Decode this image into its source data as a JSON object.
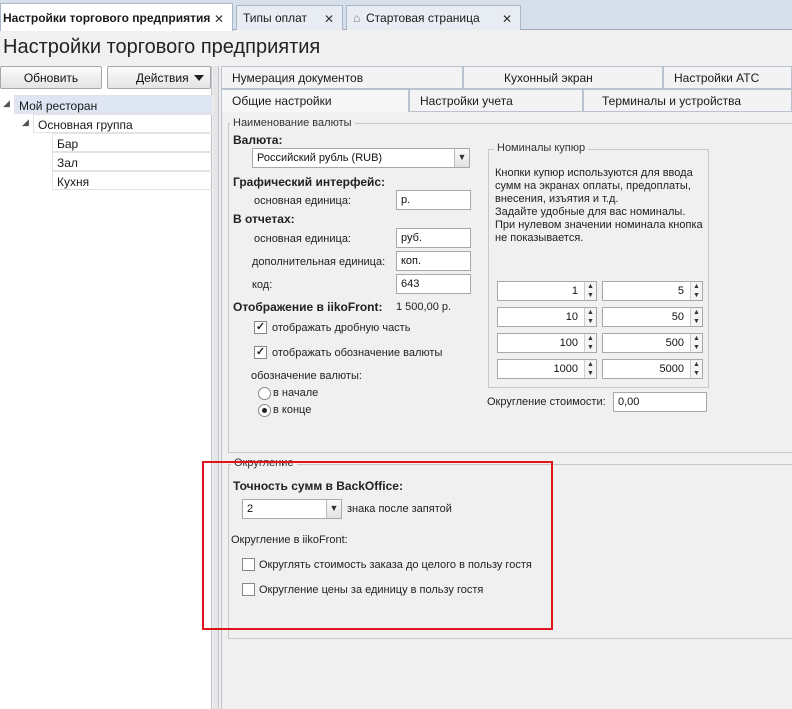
{
  "doc_tabs": [
    {
      "label": "Настройки торгового предприятия",
      "active": true
    },
    {
      "label": "Типы оплат",
      "active": false
    },
    {
      "label": "Стартовая страница",
      "active": false
    }
  ],
  "close_glyph": "✕",
  "home_glyph": "⌂",
  "page_title": "Настройки торгового предприятия",
  "toolbar": {
    "refresh_label": "Обновить",
    "actions_label": "Действия"
  },
  "tree": {
    "root": "Мой ресторан",
    "group": "Основная группа",
    "items": [
      "Бар",
      "Зал",
      "Кухня"
    ]
  },
  "settings_tabs": {
    "row1": [
      "Нумерация документов",
      "Кухонный экран",
      "Настройки АТС"
    ],
    "row2": [
      "Общие настройки",
      "Настройки учета",
      "Терминалы и устройства"
    ]
  },
  "currency_section": {
    "caption": "Наименование валюты",
    "currency_label": "Валюта:",
    "currency_value": "Российский рубль (RUB)",
    "gui_label": "Графический интерфейс:",
    "gui_main_unit_label": "основная единица:",
    "gui_main_unit_value": "р.",
    "reports_label": "В отчетах:",
    "rep_main_unit_label": "основная единица:",
    "rep_main_unit_value": "руб.",
    "rep_extra_unit_label": "дополнительная единица:",
    "rep_extra_unit_value": "коп.",
    "code_label": "код:",
    "code_value": "643",
    "display_label": "Отображение в iikoFront:",
    "display_sample": "1 500,00 р.",
    "show_fraction_label": "отображать дробную часть",
    "show_fraction_checked": true,
    "show_symbol_label": "отображать обозначение валюты",
    "show_symbol_checked": true,
    "symbol_pos_label": "обозначение валюты:",
    "pos_start_label": "в начале",
    "pos_end_label": "в конце",
    "pos_selected": "end"
  },
  "denominations": {
    "caption": "Номиналы купюр",
    "hint": [
      "Кнопки купюр используются для ввода",
      "сумм на экранах оплаты, предоплаты,",
      "внесения, изъятия и т.д.",
      "Задайте удобные для вас номиналы.",
      "При нулевом значении номинала кнопка",
      "не показывается."
    ],
    "values": [
      "1",
      "5",
      "10",
      "50",
      "100",
      "500",
      "1000",
      "5000"
    ],
    "rounding_label": "Округление стоимости:",
    "rounding_value": "0,00"
  },
  "rounding_section": {
    "caption": "Округление",
    "precision_label": "Точность сумм в BackOffice:",
    "precision_value": "2",
    "precision_suffix": "знака после запятой",
    "front_label": "Округление в iikoFront:",
    "round_order_label": "Округлять стоимость заказа до целого в пользу гостя",
    "round_order_checked": false,
    "round_unit_label": "Округление цены за единицу в пользу гостя",
    "round_unit_checked": false
  },
  "colors": {
    "highlight": "#e0151b",
    "tab_strip": "#d7dfea"
  },
  "icons": {
    "checkbox_checked": "✓",
    "combo_arrow": "▼",
    "spin_up": "▲",
    "spin_down": "▼",
    "tree_expanded": "◢"
  }
}
